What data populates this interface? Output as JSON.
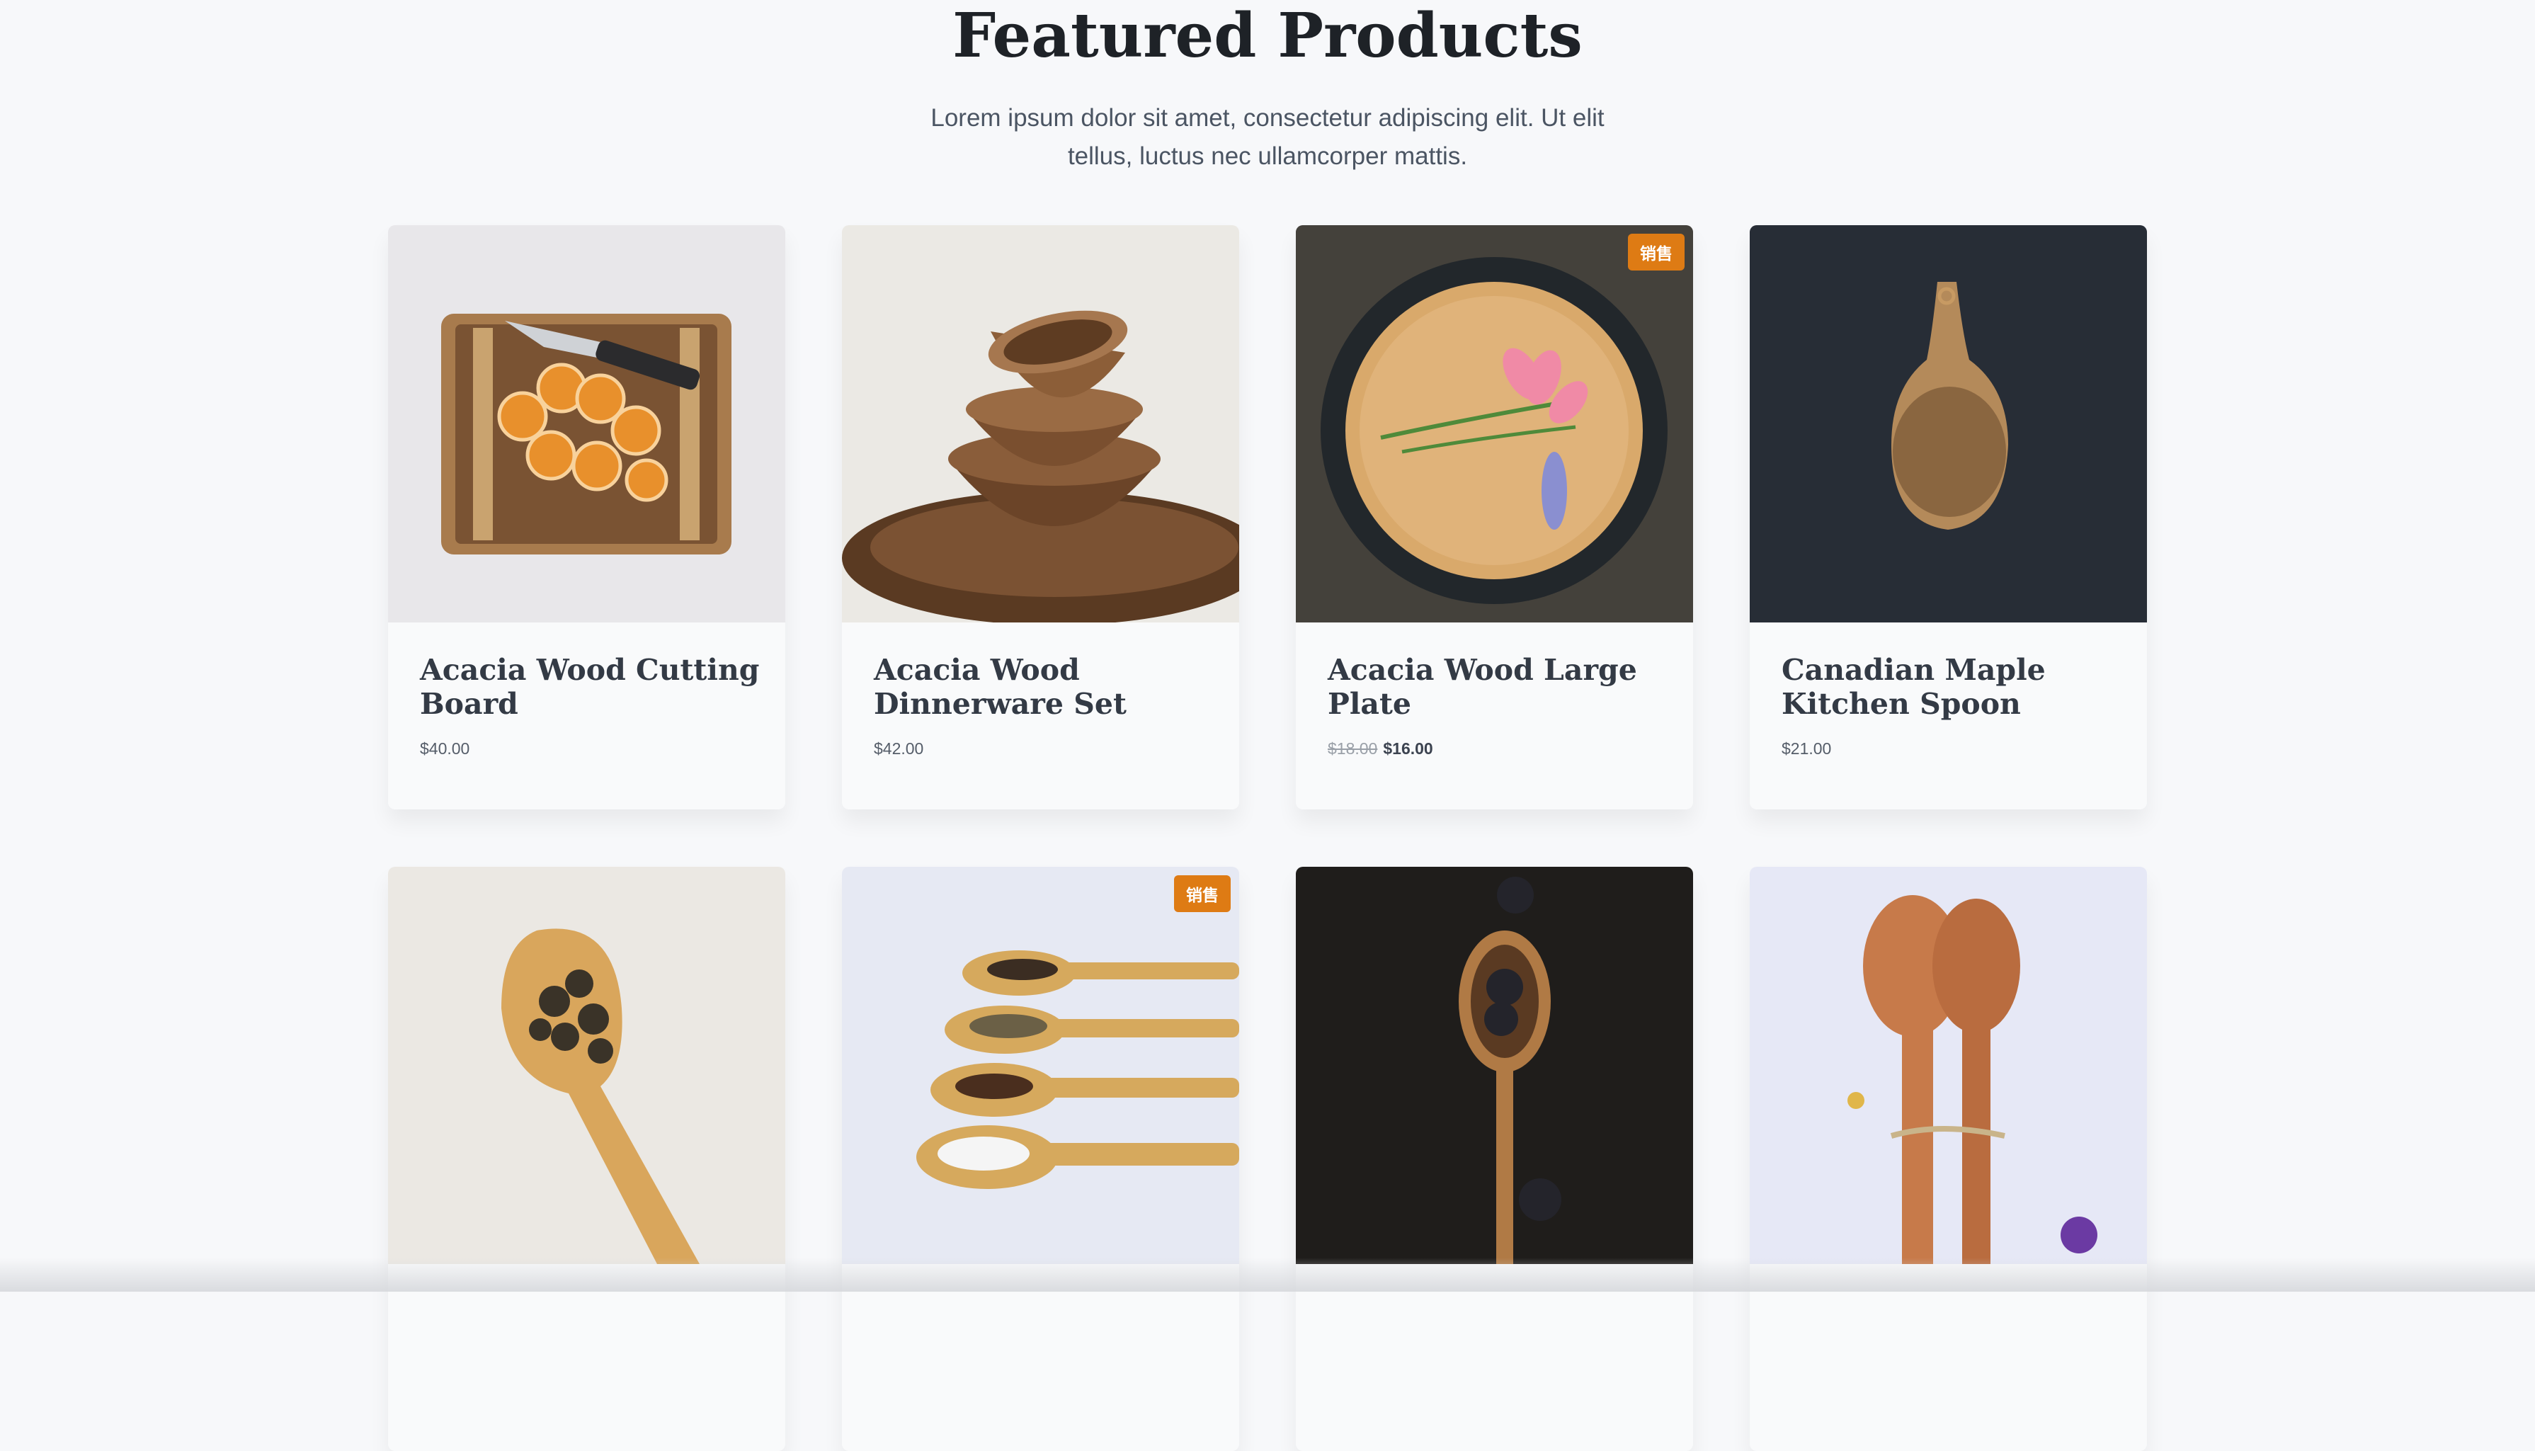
{
  "section": {
    "title": "Featured Products",
    "subtitle_line1": "Lorem ipsum dolor sit amet, consectetur adipiscing elit. Ut elit",
    "subtitle_line2": "tellus, luctus nec ullamcorper mattis."
  },
  "products": [
    {
      "title_line1": "Acacia Wood Cutting",
      "title_line2": "Board",
      "price": "$40.00"
    },
    {
      "title_line1": "Acacia Wood",
      "title_line2": "Dinnerware Set",
      "price": "$42.00"
    },
    {
      "title_line1": "Acacia Wood Large",
      "title_line2": "Plate",
      "old_price": "$18.00",
      "new_price": "$16.00",
      "badge": "销售"
    },
    {
      "title_line1": "Canadian Maple",
      "title_line2": "Kitchen Spoon",
      "price": "$21.00"
    }
  ],
  "second_row_badge": "销售",
  "colors": {
    "badge": "#de7b14",
    "heading": "#1e2227",
    "background": "#f7f8fa"
  }
}
